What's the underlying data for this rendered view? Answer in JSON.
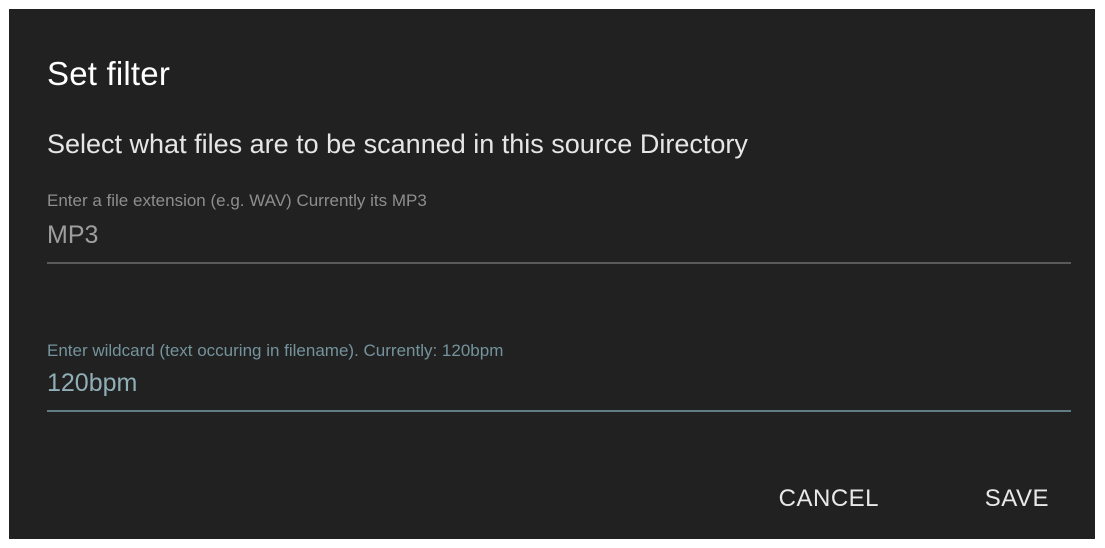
{
  "dialog": {
    "title": "Set filter",
    "subtitle": "Select what files are to be scanned in this source Directory",
    "extension_field": {
      "label": "Enter a file extension (e.g. WAV) Currently its MP3",
      "value": "MP3"
    },
    "wildcard_field": {
      "label": "Enter wildcard (text occuring in filename). Currently: 120bpm",
      "value": "120bpm"
    },
    "actions": {
      "cancel_label": "CANCEL",
      "save_label": "SAVE"
    }
  },
  "colors": {
    "dialog_background": "#212121",
    "focused_accent": "#607d86"
  }
}
